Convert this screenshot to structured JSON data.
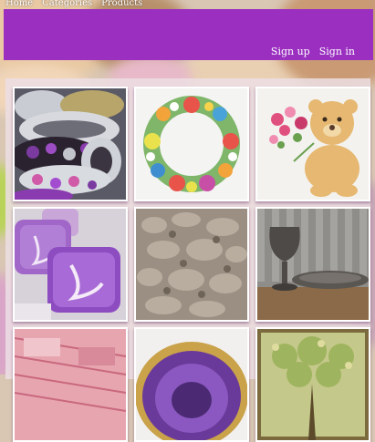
{
  "nav": {
    "items": [
      "Home",
      "Categories",
      "Products"
    ]
  },
  "auth": {
    "signup": "Sign up",
    "signin": "Sign in"
  },
  "colors": {
    "header": "#9a2fc0",
    "panel": "#ecdee4"
  },
  "gallery": [
    {
      "name": "jewelry",
      "icon": "bracelets-image"
    },
    {
      "name": "quilling-wreath",
      "icon": "paper-flower-wreath-image"
    },
    {
      "name": "teddy-embroidery",
      "icon": "teddy-bear-cross-stitch-image"
    },
    {
      "name": "soap",
      "icon": "purple-soap-bars-image"
    },
    {
      "name": "carving",
      "icon": "wood-carving-image"
    },
    {
      "name": "metal-glass",
      "icon": "metal-goblet-image"
    },
    {
      "name": "textile",
      "icon": "pink-fabric-image"
    },
    {
      "name": "geode",
      "icon": "amethyst-geode-image"
    },
    {
      "name": "painting",
      "icon": "green-tree-painting-image"
    }
  ]
}
